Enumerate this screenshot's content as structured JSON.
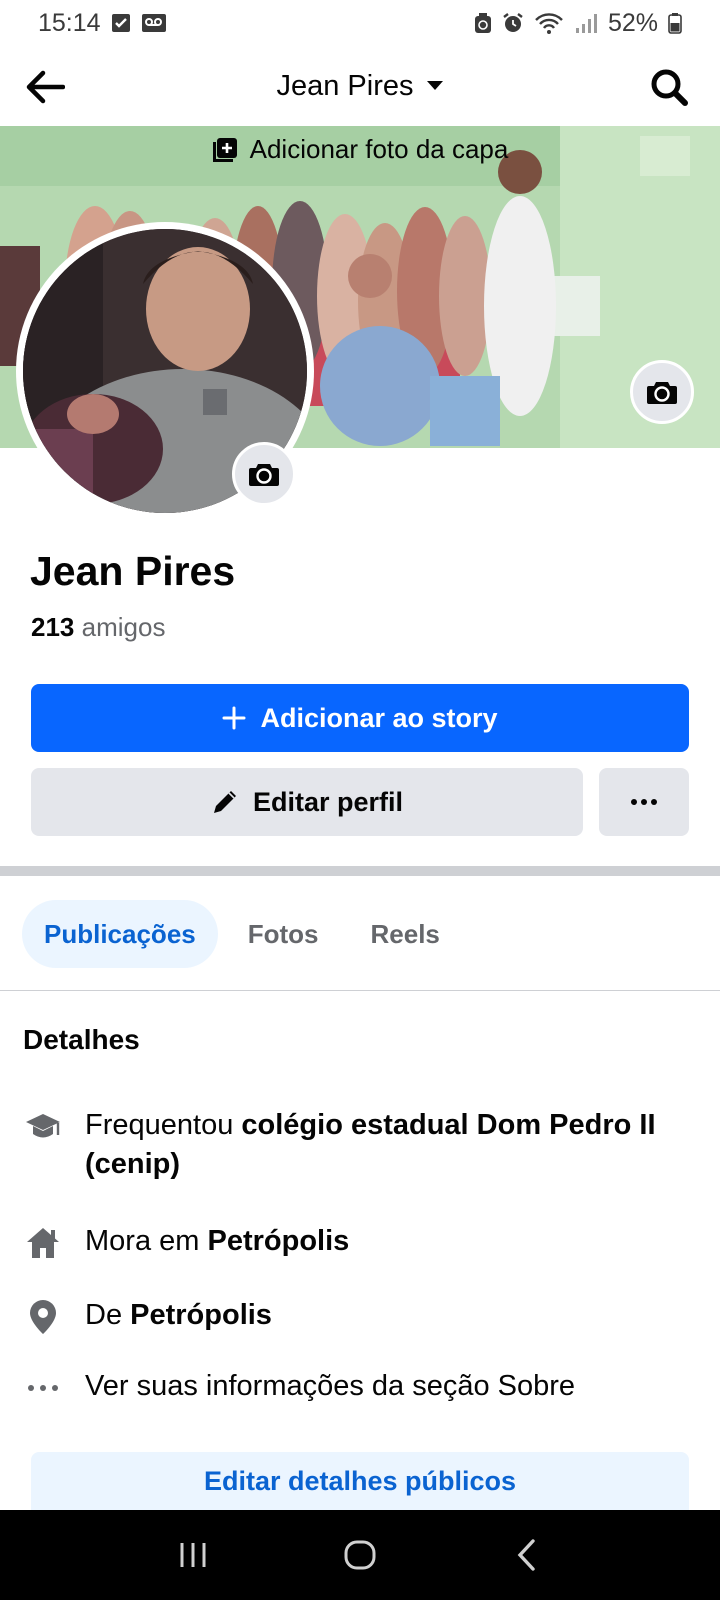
{
  "status_bar": {
    "time": "15:14",
    "battery": "52%"
  },
  "header": {
    "title": "Jean Pires"
  },
  "cover": {
    "add_cover_label": "Adicionar foto da capa"
  },
  "profile": {
    "name": "Jean Pires",
    "friends_count": "213",
    "friends_label": "amigos"
  },
  "actions": {
    "add_story": "Adicionar ao story",
    "edit_profile": "Editar perfil"
  },
  "tabs": [
    {
      "label": "Publicações",
      "active": true
    },
    {
      "label": "Fotos",
      "active": false
    },
    {
      "label": "Reels",
      "active": false
    }
  ],
  "details": {
    "title": "Detalhes",
    "items": [
      {
        "icon": "graduation-cap-icon",
        "prefix": "Frequentou ",
        "bold": "colégio estadual Dom Pedro II (cenip)"
      },
      {
        "icon": "home-icon",
        "prefix": "Mora em ",
        "bold": "Petrópolis"
      },
      {
        "icon": "location-pin-icon",
        "prefix": "De ",
        "bold": "Petrópolis"
      },
      {
        "icon": "more-dots-icon",
        "prefix": "Ver suas informações da seção Sobre",
        "bold": ""
      }
    ],
    "edit_button": "Editar detalhes públicos"
  },
  "colors": {
    "primary": "#0866ff",
    "secondary_bg": "#e4e6eb",
    "tab_active_bg": "#ebf5ff",
    "tab_active_text": "#0a63d1"
  }
}
